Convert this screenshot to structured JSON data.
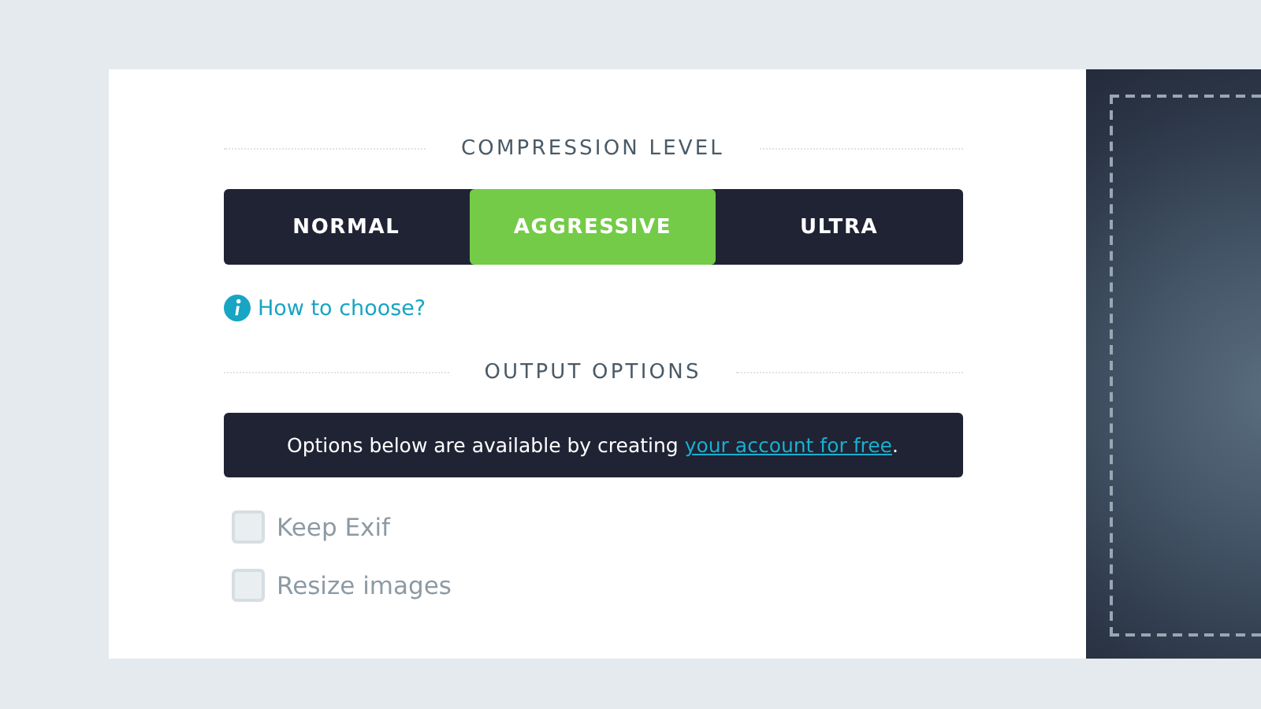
{
  "compression": {
    "heading": "COMPRESSION LEVEL",
    "options": [
      {
        "label": "NORMAL",
        "selected": false
      },
      {
        "label": "AGGRESSIVE",
        "selected": true
      },
      {
        "label": "ULTRA",
        "selected": false
      }
    ],
    "help_link": "How to choose?"
  },
  "output": {
    "heading": "OUTPUT OPTIONS",
    "notice": {
      "text": "Options below are available by creating ",
      "link": "your account for free",
      "end": "."
    },
    "checkboxes": [
      {
        "label": "Keep Exif",
        "checked": false,
        "disabled": true
      },
      {
        "label": "Resize images",
        "checked": false,
        "disabled": true
      }
    ]
  }
}
